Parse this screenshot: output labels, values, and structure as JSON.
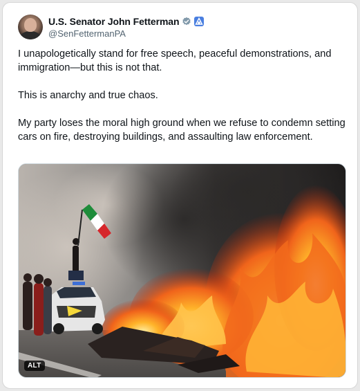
{
  "tweet": {
    "author": {
      "display_name": "U.S. Senator John Fetterman",
      "handle": "@SenFettermanPA",
      "verified_icon": "verified-badge-icon",
      "affiliation_icon": "government-affiliation-icon"
    },
    "paragraphs": [
      "I unapologetically stand for free speech, peaceful demonstrations, and immigration—but this is not that.",
      "This is anarchy and true chaos.",
      "My party loses the moral high ground when we refuse to condemn setting cars on fire, destroying buildings, and assaulting law enforcement."
    ],
    "media": {
      "alt_label": "ALT"
    }
  },
  "colors": {
    "text_primary": "#0f1419",
    "text_secondary": "#536471",
    "verified_blue": "#1d9bf0",
    "government_badge": "#4a7fe0",
    "flag_green": "#1e8c3a",
    "flag_white": "#ffffff",
    "flag_red": "#d6262b"
  }
}
